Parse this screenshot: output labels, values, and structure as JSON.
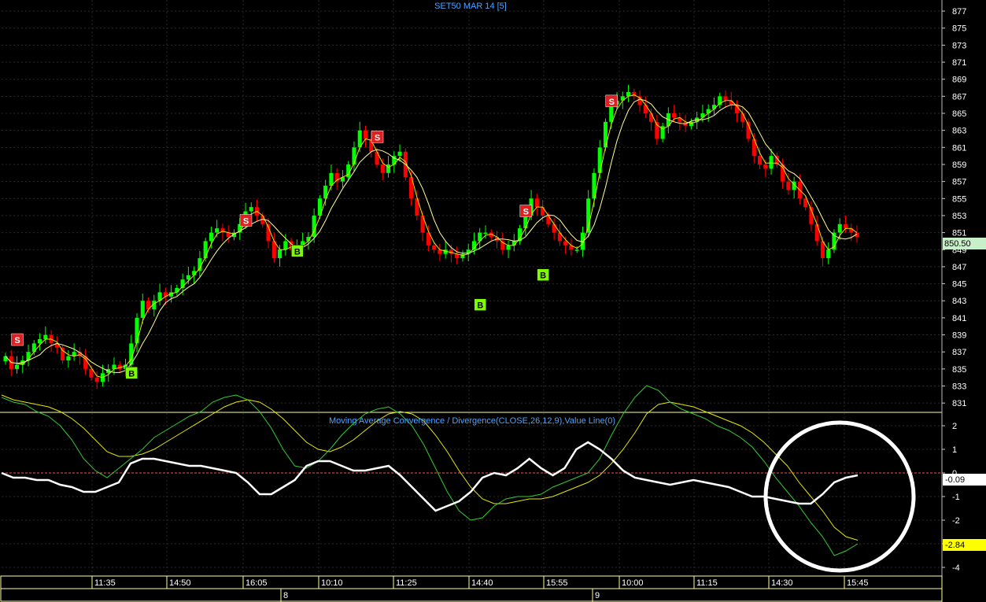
{
  "chart_data": [
    {
      "type": "candlestick",
      "title": "SET50 MAR 14  [5]",
      "yticks": [
        831,
        833,
        835,
        837,
        839,
        841,
        843,
        845,
        847,
        849,
        851,
        853,
        855,
        857,
        859,
        861,
        863,
        865,
        867,
        869,
        871,
        873,
        875,
        877
      ],
      "ylim": [
        830,
        878.3
      ],
      "last_value_label": "850.50",
      "last_value": 850.5,
      "series": [
        {
          "name": "close",
          "color": "#00ff00"
        },
        {
          "name": "ma_fast",
          "color": "#e8e800"
        },
        {
          "name": "ma_slow",
          "color": "#ffff99"
        }
      ],
      "closes": [
        836.5,
        835,
        835.5,
        836,
        837,
        838,
        838.5,
        839,
        838,
        837.5,
        836,
        836.5,
        837,
        836.5,
        835,
        834,
        833.5,
        834.5,
        835,
        835.5,
        835,
        835.5,
        838,
        841,
        843,
        842,
        843,
        844,
        843.5,
        844,
        844.5,
        845.5,
        846,
        846.5,
        848,
        850,
        851,
        851.5,
        851,
        850.5,
        851,
        852,
        853.5,
        854,
        853,
        852,
        850,
        848,
        849,
        850,
        849,
        849.5,
        850,
        850.5,
        853,
        855,
        856.5,
        858,
        857,
        857.5,
        859,
        861,
        863,
        862,
        860.5,
        859,
        858,
        859,
        860,
        860.5,
        857.5,
        855,
        853,
        851,
        849.5,
        849,
        848.5,
        849,
        848.5,
        848,
        848.5,
        849,
        850,
        851,
        851,
        850.5,
        850,
        849,
        849.5,
        850,
        851.5,
        853,
        855,
        854,
        853,
        852,
        851,
        850,
        849.5,
        849,
        849,
        851,
        855,
        858,
        861,
        864,
        866,
        866.5,
        867,
        867.5,
        867,
        866,
        865,
        864,
        862,
        863.5,
        865,
        864.5,
        864,
        863.5,
        864,
        864.5,
        865,
        865.5,
        866,
        867,
        866.5,
        866,
        865,
        864,
        862,
        860,
        859,
        858.5,
        860,
        859,
        857,
        856,
        857,
        855,
        854,
        852,
        850,
        848,
        849,
        851,
        852,
        851.5,
        851,
        850.5
      ],
      "signals": [
        {
          "label": "S",
          "index": 2,
          "price": 838.4
        },
        {
          "label": "B",
          "index": 22,
          "price": 834.5
        },
        {
          "label": "S",
          "index": 42,
          "price": 852.4
        },
        {
          "label": "B",
          "index": 51,
          "price": 848.8
        },
        {
          "label": "S",
          "index": 65,
          "price": 862.2
        },
        {
          "label": "B",
          "index": 83,
          "price": 842.5
        },
        {
          "label": "S",
          "index": 91,
          "price": 853.5
        },
        {
          "label": "B",
          "index": 94,
          "price": 846.0
        },
        {
          "label": "S",
          "index": 106,
          "price": 866.4
        }
      ]
    },
    {
      "type": "line",
      "title": "Moving Average Convergence / Divergence(CLOSE,26,12,9),Value Line(0)",
      "yticks": [
        2,
        1,
        0,
        -1,
        -2,
        -3,
        -4
      ],
      "ylim": [
        -4.3,
        2.5
      ],
      "zero_line": 0,
      "series": [
        {
          "name": "MACD",
          "color": "#33cc33",
          "last": -2.84
        },
        {
          "name": "Signal",
          "color": "#e8e800",
          "last": -2.84
        },
        {
          "name": "Value",
          "color": "#ffffff",
          "last": -0.09
        }
      ],
      "last_labels": {
        "value": "-0.09",
        "macd": "-2.84"
      },
      "macd": [
        3.2,
        3.0,
        2.9,
        2.6,
        2.4,
        2.0,
        1.4,
        0.6,
        0.1,
        -0.2,
        0.2,
        0.6,
        1.0,
        1.5,
        1.8,
        2.1,
        2.4,
        2.6,
        3.0,
        3.2,
        3.3,
        3.1,
        2.6,
        1.9,
        1.0,
        0.3,
        0.2,
        0.5,
        1.0,
        1.6,
        2.1,
        2.5,
        2.7,
        2.8,
        2.5,
        2.0,
        1.2,
        0.2,
        -0.8,
        -1.6,
        -2.0,
        -1.9,
        -1.4,
        -1.1,
        -1.0,
        -1.0,
        -0.9,
        -0.6,
        -0.4,
        -0.2,
        0.0,
        0.6,
        1.6,
        2.5,
        3.2,
        3.7,
        3.5,
        3.0,
        2.7,
        2.5,
        2.3,
        2.0,
        1.8,
        1.5,
        1.1,
        0.5,
        -0.2,
        -0.8,
        -1.4,
        -2.1,
        -2.7,
        -3.5,
        -3.3,
        -3.0
      ],
      "signal": [
        3.3,
        3.1,
        3.0,
        2.9,
        2.8,
        2.6,
        2.3,
        1.9,
        1.4,
        0.9,
        0.7,
        0.7,
        0.8,
        1.0,
        1.3,
        1.6,
        1.9,
        2.2,
        2.5,
        2.8,
        3.0,
        3.1,
        3.0,
        2.7,
        2.3,
        1.8,
        1.3,
        1.0,
        0.9,
        1.1,
        1.4,
        1.8,
        2.2,
        2.5,
        2.6,
        2.5,
        2.2,
        1.6,
        0.9,
        0.1,
        -0.6,
        -1.1,
        -1.3,
        -1.3,
        -1.2,
        -1.1,
        -1.1,
        -1.0,
        -0.8,
        -0.6,
        -0.4,
        -0.1,
        0.4,
        1.0,
        1.7,
        2.5,
        2.9,
        3.0,
        2.9,
        2.8,
        2.6,
        2.4,
        2.2,
        2.0,
        1.7,
        1.3,
        0.8,
        0.3,
        -0.4,
        -1.0,
        -1.6,
        -2.3,
        -2.7,
        -2.85
      ],
      "value": [
        0.0,
        -0.2,
        -0.2,
        -0.3,
        -0.3,
        -0.5,
        -0.6,
        -0.8,
        -0.8,
        -0.6,
        -0.4,
        0.4,
        0.6,
        0.6,
        0.5,
        0.4,
        0.3,
        0.3,
        0.2,
        0.1,
        0.0,
        -0.4,
        -0.9,
        -0.9,
        -0.6,
        -0.3,
        0.3,
        0.5,
        0.5,
        0.3,
        0.1,
        0.1,
        0.2,
        0.3,
        -0.1,
        -0.6,
        -1.1,
        -1.6,
        -1.4,
        -1.2,
        -0.8,
        -0.2,
        0.0,
        -0.1,
        0.2,
        0.6,
        0.2,
        -0.1,
        0.2,
        1.0,
        1.3,
        1.0,
        0.6,
        0.1,
        -0.2,
        -0.3,
        -0.4,
        -0.5,
        -0.4,
        -0.3,
        -0.4,
        -0.5,
        -0.6,
        -0.8,
        -1.0,
        -1.0,
        -1.1,
        -1.2,
        -1.3,
        -1.3,
        -0.9,
        -0.4,
        -0.2,
        -0.1
      ]
    }
  ],
  "time_axis": {
    "time_labels": [
      "11:35",
      "14:50",
      "16:05",
      "10:10",
      "11:25",
      "14:40",
      "15:55",
      "10:00",
      "11:15",
      "14:30",
      "15:45"
    ],
    "day_labels": [
      "8",
      "9"
    ]
  },
  "colors": {
    "background": "#000000",
    "grid": "#2a2a2a",
    "up_candle": "#00ff00",
    "down_candle": "#ff0000",
    "panel_border": "#ffff99",
    "title_text": "#4da3ff",
    "zero_line": "#ff5050",
    "sell_marker": "#e02020",
    "buy_marker": "#7cfc00",
    "highlight_circle": "#ffffff"
  },
  "annotations": [
    {
      "type": "circle",
      "description_color": "#ffffff"
    }
  ]
}
